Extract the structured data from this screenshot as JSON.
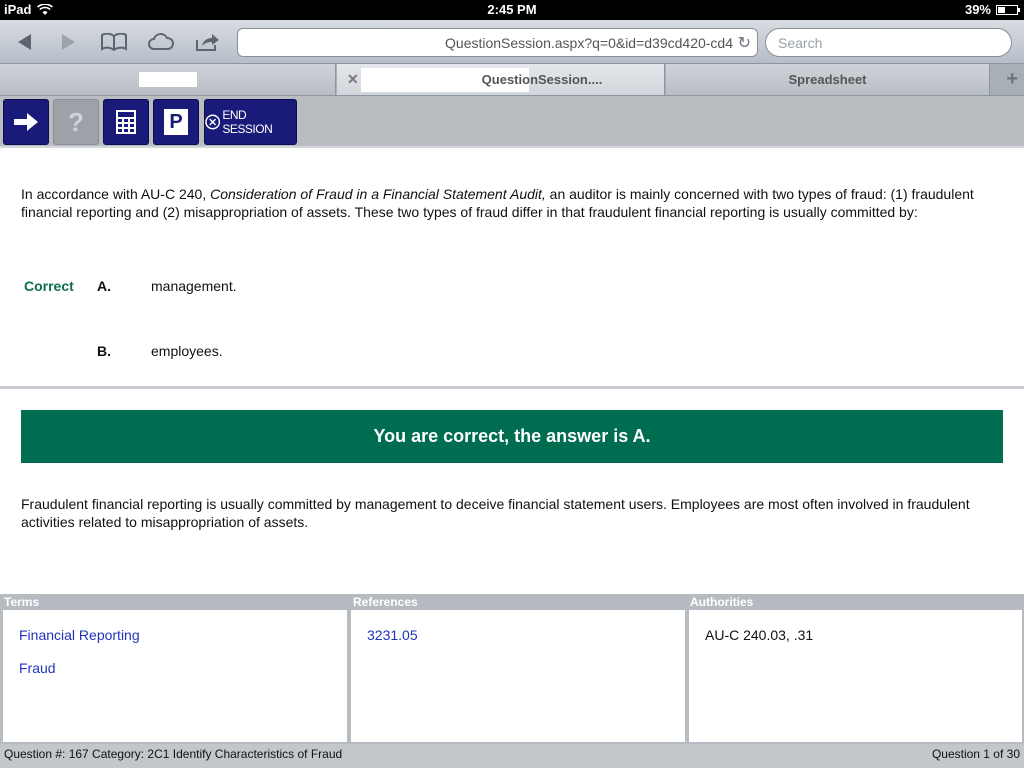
{
  "status_bar": {
    "device": "iPad",
    "time": "2:45 PM",
    "battery": "39%",
    "battery_level": 0.39,
    "wifi_icon": "wifi-icon"
  },
  "browser": {
    "url": "QuestionSession.aspx?q=0&id=d39cd420-cd4",
    "search_placeholder": "Search",
    "tabs": [
      {
        "label": ""
      },
      {
        "label": "QuestionSession...."
      },
      {
        "label": "Spreadsheet"
      }
    ],
    "new_tab_label": "+"
  },
  "app_toolbar": {
    "next_icon": "arrow-right-icon",
    "help_label": "?",
    "calculator_icon": "calculator-icon",
    "pause_label": "P",
    "end_session_label": "END SESSION"
  },
  "question": {
    "text_before": "In accordance with AU-C 240, ",
    "text_italic": "Consideration of Fraud in a Financial Statement Audit,",
    "text_after": " an auditor is mainly concerned with two types of fraud: (1) fraudulent financial reporting and (2) misappropriation of assets. These two types of fraud differ in that fraudulent financial reporting is usually committed by:",
    "choices": [
      {
        "status": "Correct",
        "letter": "A.",
        "text": "management."
      },
      {
        "status": "",
        "letter": "B.",
        "text": "employees."
      }
    ]
  },
  "result": {
    "banner": "You are correct, the answer is A.",
    "explanation": "Fraudulent financial reporting is usually committed by management to deceive financial statement users. Employees are most often involved in fraudulent activities related to misappropriation of assets."
  },
  "panels": {
    "terms": {
      "header": "Terms",
      "items": [
        "Financial Reporting",
        "Fraud"
      ]
    },
    "references": {
      "header": "References",
      "items": [
        "3231.05"
      ]
    },
    "authorities": {
      "header": "Authorities",
      "items": [
        "AU-C 240.03, .31"
      ]
    }
  },
  "footer": {
    "left": "Question #: 167 Category: 2C1 Identify Characteristics of Fraud",
    "right": "Question 1 of 30"
  },
  "colors": {
    "correct_green": "#006d50",
    "toolbar_navy": "#1a1a7a",
    "link_blue": "#2233bb"
  }
}
